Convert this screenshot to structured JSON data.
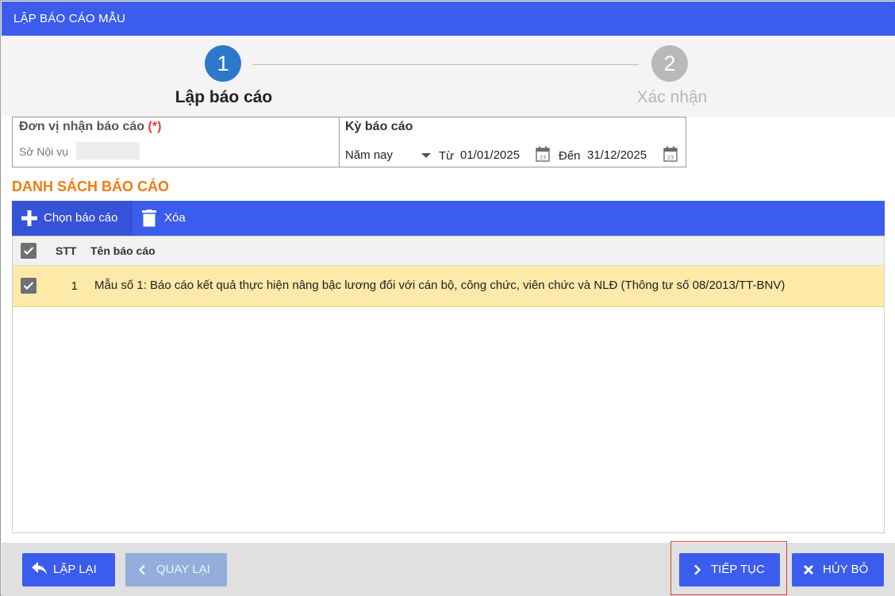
{
  "window": {
    "title": "LẬP BÁO CÁO MẪU"
  },
  "stepper": {
    "steps": [
      {
        "number": "1",
        "label": "Lập báo cáo",
        "active": true
      },
      {
        "number": "2",
        "label": "Xác nhận",
        "active": false
      }
    ]
  },
  "form": {
    "unit_label": "Đơn vị nhận báo cáo",
    "required_mark": "(*)",
    "unit_value": "Sở Nội vụ",
    "period_label": "Kỳ báo cáo",
    "period_selected": "Năm nay",
    "from_label": "Từ",
    "from_date": "01/01/2025",
    "to_label": "Đến",
    "to_date": "31/12/2025"
  },
  "list": {
    "title": "DANH SÁCH BÁO CÁO",
    "toolbar": {
      "choose_label": "Chọn báo cáo",
      "delete_label": "Xóa"
    },
    "columns": {
      "stt": "STT",
      "name": "Tên báo cáo"
    },
    "rows": [
      {
        "stt": "1",
        "name": "Mẫu số 1: Báo cáo kết quả thực hiện nâng bậc lương đối với cán bộ, công chức, viên chức và NLĐ (Thông tư số 08/2013/TT-BNV)",
        "checked": true
      }
    ]
  },
  "footer": {
    "reset_label": "LẬP LẠI",
    "back_label": "QUAY LẠI",
    "next_label": "TIẾP TỤC",
    "cancel_label": "HỦY BỎ"
  },
  "colors": {
    "primary": "#3c5ced",
    "step_active": "#2e78c9",
    "step_inactive": "#b9b9b9",
    "section_title": "#f07b11",
    "selected_row": "#fde9a8",
    "required": "#e53935",
    "highlight": "#e53935"
  },
  "icons": {
    "choose": "plus-icon",
    "delete": "trash-icon",
    "calendar": "calendar-icon",
    "reset": "undo-arrow-icon",
    "back": "chevron-left-icon",
    "next": "chevron-right-icon",
    "cancel": "close-icon"
  }
}
